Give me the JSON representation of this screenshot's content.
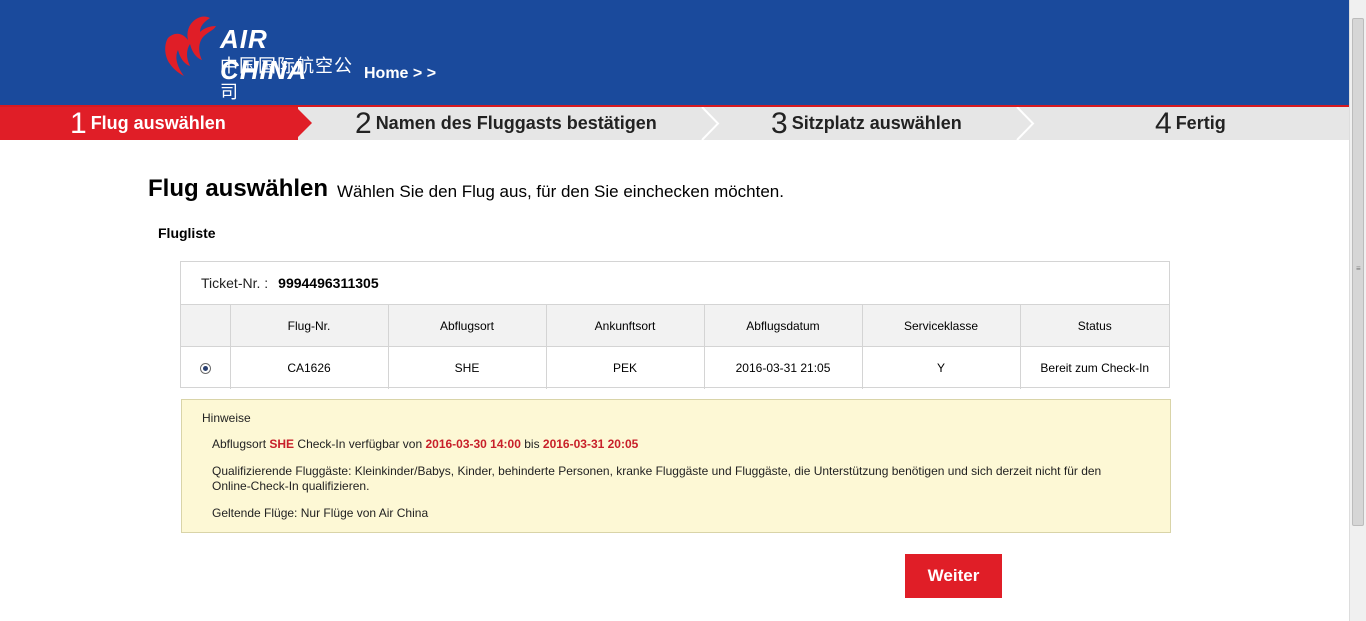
{
  "header": {
    "logo_en": "AIR CHINA",
    "logo_cn": "中国国际航空公司",
    "breadcrumb": "Home > >"
  },
  "steps": [
    {
      "num": "1",
      "label": "Flug auswählen",
      "active": true
    },
    {
      "num": "2",
      "label": "Namen des Fluggasts bestätigen",
      "active": false
    },
    {
      "num": "3",
      "label": "Sitzplatz auswählen",
      "active": false
    },
    {
      "num": "4",
      "label": "Fertig",
      "active": false
    }
  ],
  "main": {
    "title": "Flug auswählen",
    "subtitle": "Wählen Sie den Flug aus, für den Sie einchecken möchten.",
    "section_title": "Flugliste",
    "ticket_label": "Ticket-Nr. :",
    "ticket_number": "9994496311305",
    "columns": [
      "Flug-Nr.",
      "Abflugsort",
      "Ankunftsort",
      "Abflugsdatum",
      "Serviceklasse",
      "Status"
    ],
    "rows": [
      {
        "flight": "CA1626",
        "from": "SHE",
        "to": "PEK",
        "date": "2016-03-31 21:05",
        "class": "Y",
        "status": "Bereit zum Check-In",
        "selected": true
      }
    ]
  },
  "notes": {
    "title": "Hinweise",
    "line1_a": "Abflugsort ",
    "line1_airport": "SHE",
    "line1_b": " Check-In verfügbar von ",
    "line1_from": "2016-03-30 14:00",
    "line1_c": " bis ",
    "line1_to": "2016-03-31 20:05",
    "line2": "Qualifizierende Fluggäste: Kleinkinder/Babys, Kinder, behinderte Personen, kranke Fluggäste und Fluggäste, die Unterstützung benötigen und sich derzeit nicht für den Online-Check-In qualifizieren.",
    "line3": "Geltende Flüge: Nur Flüge von Air China"
  },
  "actions": {
    "next_label": "Weiter"
  },
  "colors": {
    "header_blue": "#1a4a9c",
    "accent_red": "#e01e27",
    "notes_bg": "#fdf8d5"
  }
}
